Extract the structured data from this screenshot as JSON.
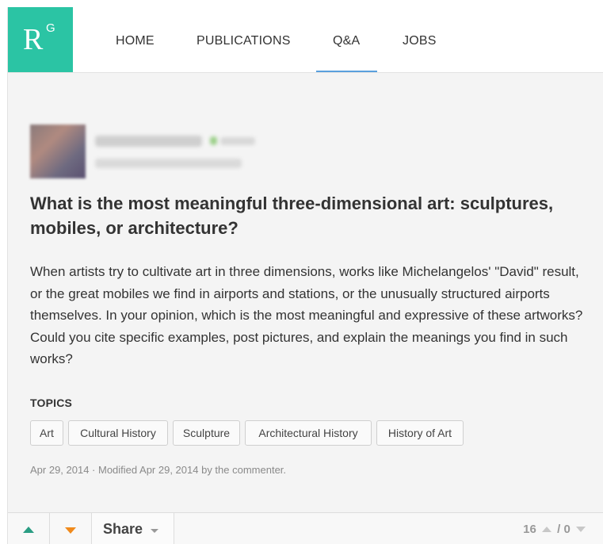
{
  "brand": {
    "logo_letter": "R",
    "logo_superscript": "G",
    "accent_color": "#2bc4a4"
  },
  "nav": {
    "items": [
      {
        "label": "HOME"
      },
      {
        "label": "PUBLICATIONS"
      },
      {
        "label": "Q&A",
        "active": true
      },
      {
        "label": "JOBS"
      }
    ],
    "active_color": "#5aa0dd"
  },
  "question": {
    "title": "What is the most meaningful three-dimensional art: sculptures, mobiles, or architecture?",
    "body": "When artists try to cultivate art in three dimensions, works like Michelangelos' \"David\" result, or the great mobiles we find in airports and stations, or the unusually structured airports themselves. In your opinion, which is the most meaningful and expressive of these artworks? Could you cite specific examples, post pictures, and explain the meanings you find in such works?",
    "topics_label": "TOPICS",
    "topics": [
      "Art",
      "Cultural History",
      "Sculpture",
      "Architectural History",
      "History of Art"
    ],
    "meta": "Apr 29, 2014 · Modified Apr 29, 2014 by the commenter."
  },
  "actions": {
    "upvote_icon": "triangle-up-icon",
    "downvote_icon": "triangle-down-icon",
    "upvote_color": "#2a9d83",
    "downvote_color": "#f08a1c",
    "share_label": "Share",
    "upvotes": "16",
    "separator": "/",
    "downvotes": "0"
  }
}
